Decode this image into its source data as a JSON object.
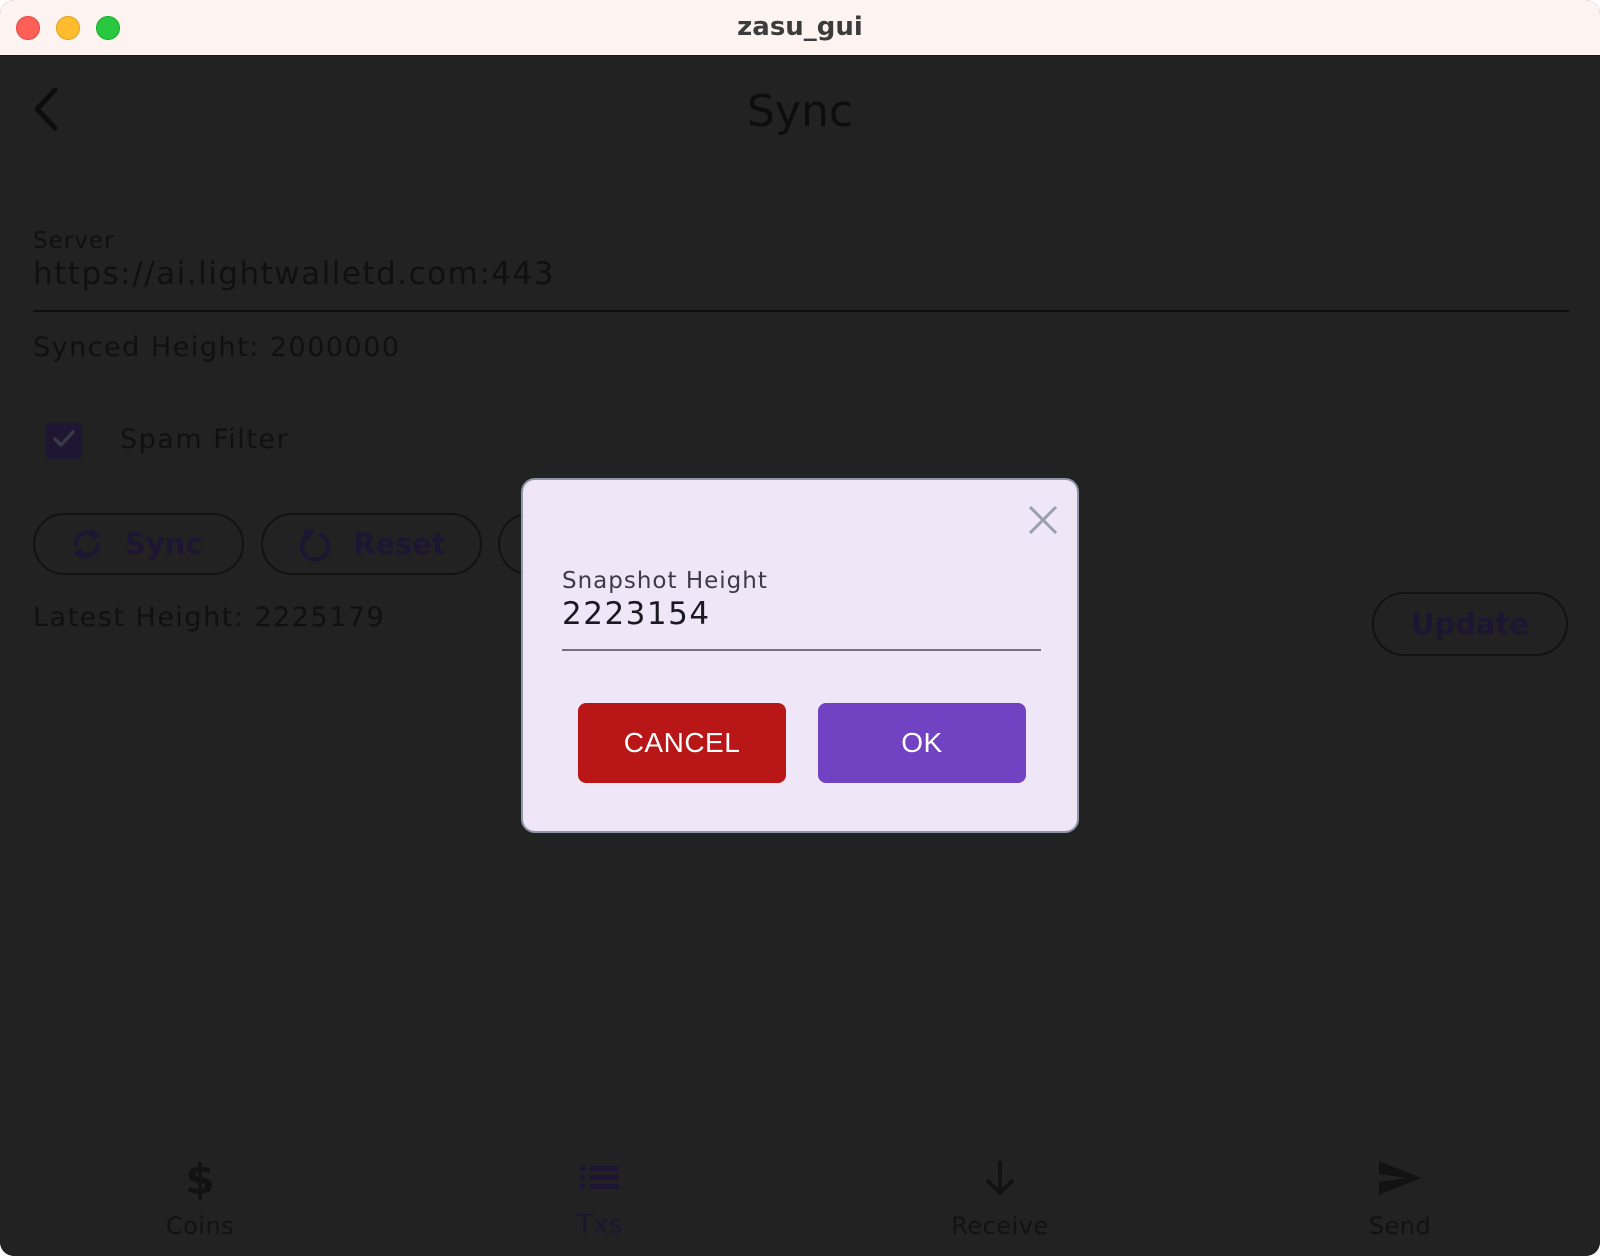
{
  "window": {
    "title": "zasu_gui"
  },
  "header": {
    "title": "Sync"
  },
  "server": {
    "label": "Server",
    "value": "https://ai.lightwalletd.com:443"
  },
  "synced_height": "Synced Height: 2000000",
  "spam_filter": {
    "label": "Spam Filter",
    "checked": true
  },
  "actions": {
    "sync_label": "Sync",
    "reset_label": "Reset"
  },
  "latest_height": "Latest Height: 2225179",
  "update_label": "Update",
  "bottom_nav": {
    "items": [
      {
        "label": "Coins",
        "icon": "dollar-icon"
      },
      {
        "label": "Txs",
        "icon": "list-icon"
      },
      {
        "label": "Receive",
        "icon": "arrow-down-icon"
      },
      {
        "label": "Send",
        "icon": "send-icon"
      }
    ],
    "active": "Txs"
  },
  "dialog": {
    "field_label": "Snapshot Height",
    "field_value": "2223154",
    "cancel_label": "CANCEL",
    "ok_label": "OK"
  },
  "colors": {
    "background": "#222222",
    "dialog_bg": "#efe6f7",
    "cancel": "#b91717",
    "ok": "#7143c2",
    "accent_dark": "#1c1633",
    "titlebar": "#fdf3f1"
  }
}
